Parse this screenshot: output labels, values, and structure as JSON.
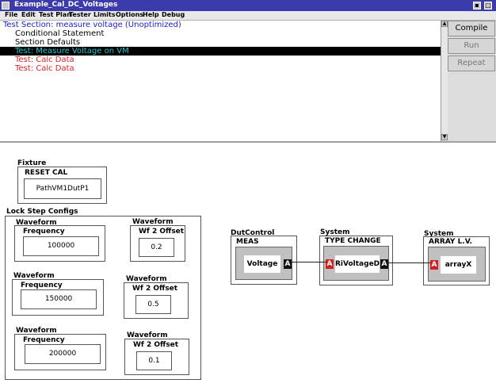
{
  "window": {
    "title": "Example_Cal_DC_Voltages"
  },
  "menu": [
    "File",
    "Edit",
    "Test Plan",
    "Tester",
    "Limits",
    "Options",
    "Help",
    "Debug"
  ],
  "test_list": [
    {
      "text": "Test Section: measure voltage (Unoptimized)",
      "color": "#1a1ad0"
    },
    {
      "text": "Conditional Statement",
      "color": "#000000"
    },
    {
      "text": "Section Defaults",
      "color": "#000000"
    },
    {
      "text": "Test: Measure Voltage on VM",
      "color": "#20c8d0",
      "selected": true
    },
    {
      "text": "Test: Calc Data",
      "color": "#e02020"
    },
    {
      "text": "Test: Calc Data",
      "color": "#e02020"
    }
  ],
  "buttons": {
    "compile": "Compile",
    "run": "Run",
    "repeat": "Repeat"
  },
  "fixture": {
    "title": "Fixture",
    "subtitle": "RESET CAL",
    "value": "PathVM1DutP1"
  },
  "lockstep": {
    "title": "Lock Step Configs",
    "rows": [
      {
        "freq_title": "Waveform",
        "freq_label": "Frequency",
        "freq_value": "100000",
        "wf_title": "Waveform",
        "wf_label": "Wf 2 Offset",
        "wf_value": "0.2"
      },
      {
        "freq_title": "Waveform",
        "freq_label": "Frequency",
        "freq_value": "150000",
        "wf_title": "Waveform",
        "wf_label": "Wf 2 Offset",
        "wf_value": "0.5"
      },
      {
        "freq_title": "Waveform",
        "freq_label": "Frequency",
        "freq_value": "200000",
        "wf_title": "Waveform",
        "wf_label": "Wf 2 Offset",
        "wf_value": "0.1"
      }
    ]
  },
  "flow": {
    "dutcontrol": {
      "title": "DutControl",
      "subtitle": "MEAS",
      "value": "Voltage",
      "out_port": "A"
    },
    "system1": {
      "title": "System",
      "subtitle": "TYPE CHANGE",
      "value": "RiVoltageD",
      "in_port": "A",
      "out_port": "A"
    },
    "system2": {
      "title": "System",
      "subtitle": "ARRAY L.V.",
      "value": "arrayX",
      "in_port": "A"
    }
  }
}
